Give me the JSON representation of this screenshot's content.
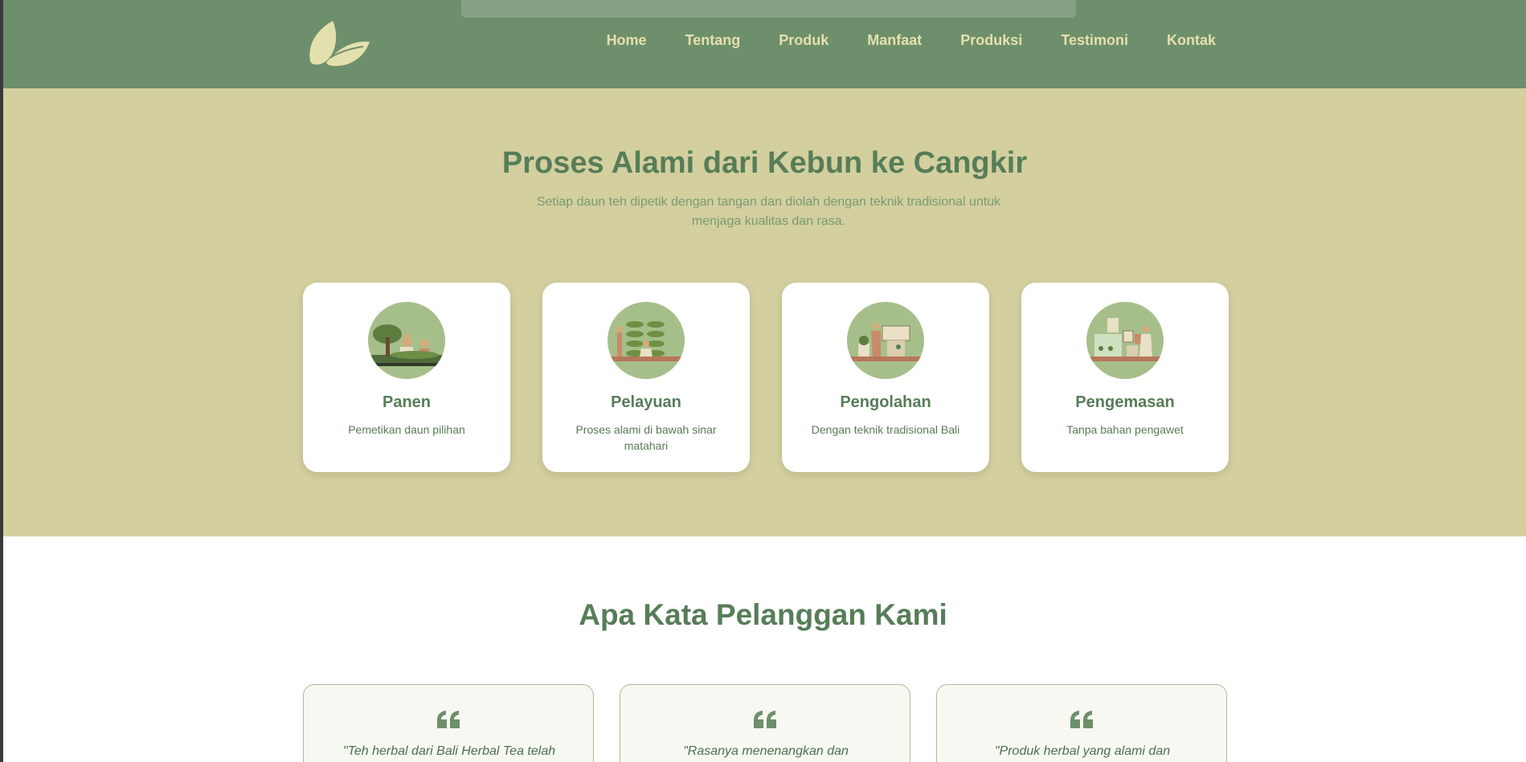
{
  "nav": {
    "logo_icon": "leaf-logo-icon",
    "links": [
      "Home",
      "Tentang",
      "Produk",
      "Manfaat",
      "Produksi",
      "Testimoni",
      "Kontak"
    ]
  },
  "process": {
    "title": "Proses Alami dari Kebun ke Cangkir",
    "subtitle": "Setiap daun teh dipetik dengan tangan dan diolah dengan teknik tradisional untuk menjaga kualitas dan rasa.",
    "steps": [
      {
        "title": "Panen",
        "desc": "Pemetikan daun pilihan",
        "icon": "harvest-illustration"
      },
      {
        "title": "Pelayuan",
        "desc": "Proses alami di bawah sinar matahari",
        "icon": "withering-illustration"
      },
      {
        "title": "Pengolahan",
        "desc": "Dengan teknik tradisional Bali",
        "icon": "processing-illustration"
      },
      {
        "title": "Pengemasan",
        "desc": "Tanpa bahan pengawet",
        "icon": "packaging-illustration"
      }
    ]
  },
  "testimonials": {
    "title": "Apa Kata Pelanggan Kami",
    "quote_icon": "quote-icon",
    "items": [
      {
        "text": "\"Teh herbal dari Bali Herbal Tea telah"
      },
      {
        "text": "\"Rasanya menenangkan dan"
      },
      {
        "text": "\"Produk herbal yang alami dan"
      }
    ]
  },
  "colors": {
    "nav_bg": "#6e8f6b",
    "nav_text": "#e4e0ad",
    "section_bg": "#d3cf9f",
    "heading": "#577d58",
    "illustration_bg": "#a6bf8a"
  }
}
